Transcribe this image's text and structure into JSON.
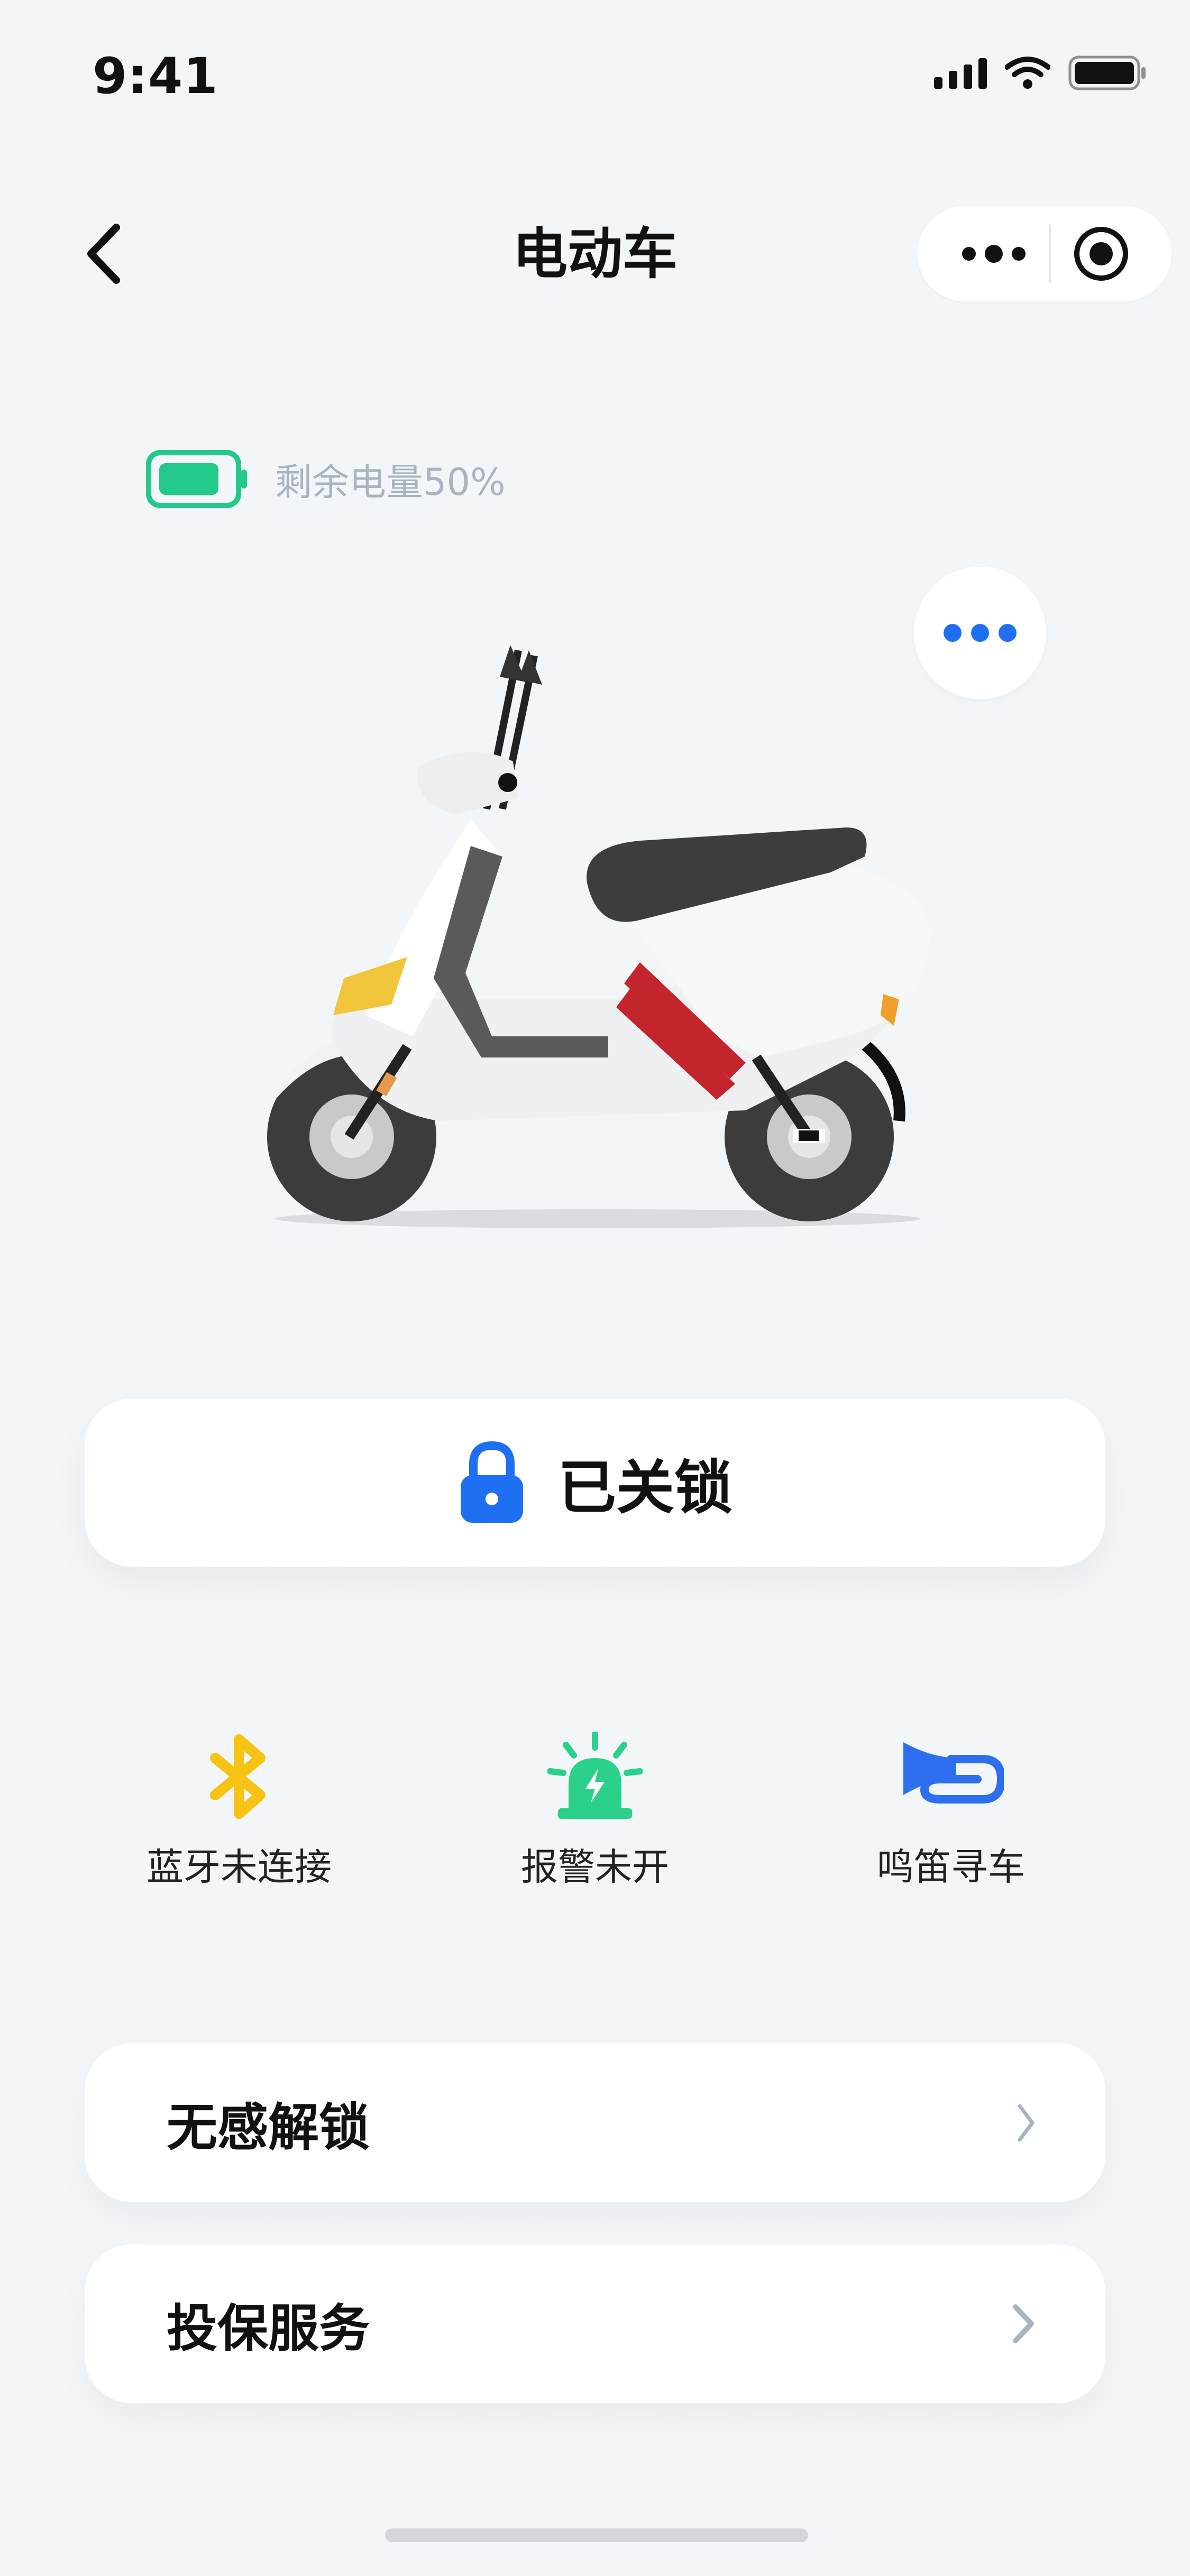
{
  "status_bar": {
    "time": "9:41",
    "icons": [
      "cellular-signal-icon",
      "wifi-icon",
      "battery-icon"
    ]
  },
  "nav": {
    "title": "电动车",
    "back_icon": "chevron-left-icon",
    "capsule_icons": [
      "more-dots-icon",
      "target-icon"
    ]
  },
  "battery": {
    "label": "剩余电量50%",
    "level_percent": 50,
    "color": "#22c98a"
  },
  "more_button": {
    "icon": "more-dots-icon",
    "color": "#1f6ff2"
  },
  "lock": {
    "label": "已关锁",
    "icon": "lock-icon",
    "color": "#1f6ff2"
  },
  "features": [
    {
      "label": "蓝牙未连接",
      "icon": "bluetooth-icon",
      "color": "#f6c315"
    },
    {
      "label": "报警未开",
      "icon": "alarm-siren-icon",
      "color": "#2bd18a"
    },
    {
      "label": "鸣笛寻车",
      "icon": "horn-icon",
      "color": "#2e6ff0"
    }
  ],
  "rows": [
    {
      "label": "无感解锁",
      "icon": "chevron-right-icon"
    },
    {
      "label": "投保服务",
      "icon": "chevron-right-icon"
    }
  ]
}
